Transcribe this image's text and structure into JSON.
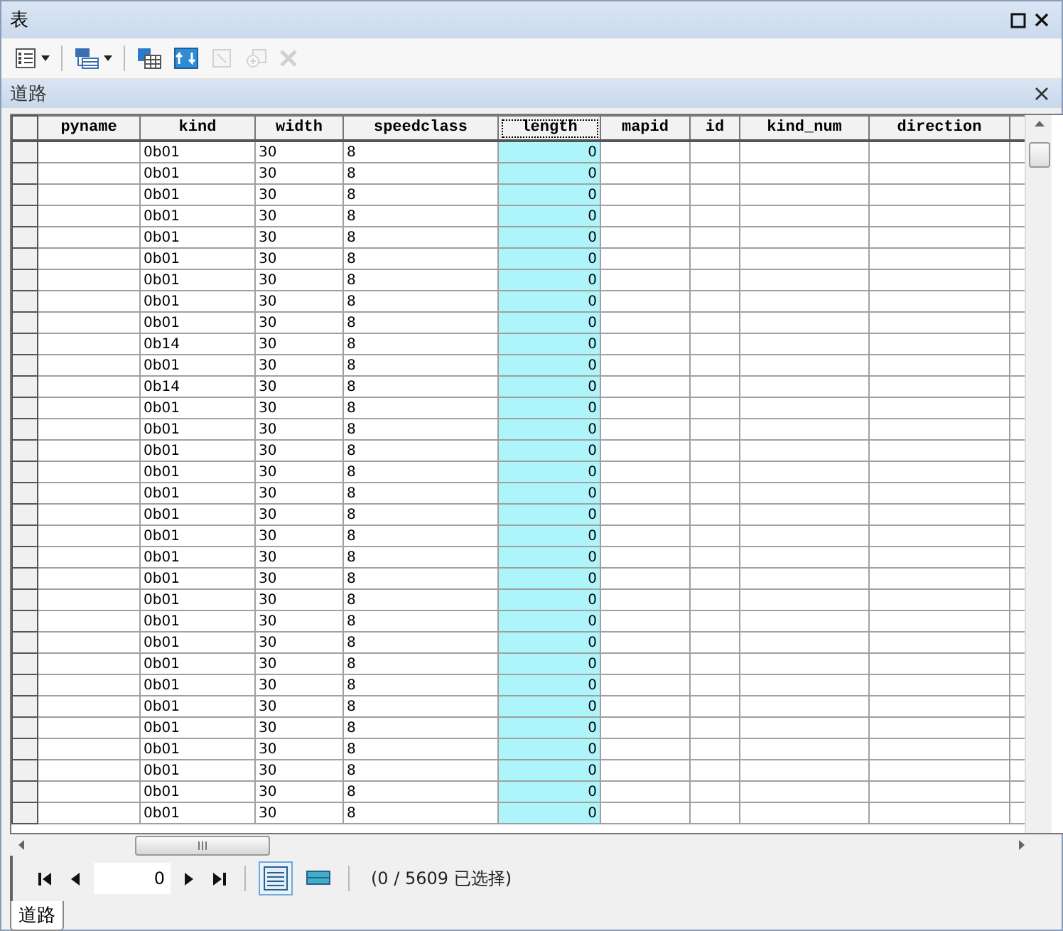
{
  "window": {
    "title": "表"
  },
  "toolbar": [
    {
      "kind": "options",
      "disabled": false,
      "dropdown": true
    },
    {
      "kind": "related",
      "disabled": false,
      "dropdown": true
    },
    {
      "kind": "select-attr",
      "disabled": false,
      "dropdown": false
    },
    {
      "kind": "switch",
      "disabled": false,
      "dropdown": false
    },
    {
      "kind": "clear",
      "disabled": true,
      "dropdown": false
    },
    {
      "kind": "zoom",
      "disabled": true,
      "dropdown": false
    },
    {
      "kind": "delete",
      "disabled": true,
      "dropdown": false
    }
  ],
  "table_title": "道路",
  "columns": [
    {
      "name": "pyname",
      "selected": false,
      "kind": "text"
    },
    {
      "name": "kind",
      "selected": false,
      "kind": "text"
    },
    {
      "name": "width",
      "selected": false,
      "kind": "text"
    },
    {
      "name": "speedclass",
      "selected": false,
      "kind": "text"
    },
    {
      "name": "length",
      "selected": true,
      "kind": "number"
    },
    {
      "name": "mapid",
      "selected": false,
      "kind": "text"
    },
    {
      "name": "id",
      "selected": false,
      "kind": "text"
    },
    {
      "name": "kind_num",
      "selected": false,
      "kind": "text"
    },
    {
      "name": "direction",
      "selected": false,
      "kind": "text"
    }
  ],
  "rows": [
    {
      "cells": [
        "",
        "0b01",
        "30",
        "8",
        "0"
      ]
    },
    {
      "cells": [
        "",
        "0b01",
        "30",
        "8",
        "0"
      ]
    },
    {
      "cells": [
        "",
        "0b01",
        "30",
        "8",
        "0"
      ]
    },
    {
      "cells": [
        "",
        "0b01",
        "30",
        "8",
        "0"
      ]
    },
    {
      "cells": [
        "",
        "0b01",
        "30",
        "8",
        "0"
      ]
    },
    {
      "cells": [
        "",
        "0b01",
        "30",
        "8",
        "0"
      ]
    },
    {
      "cells": [
        "",
        "0b01",
        "30",
        "8",
        "0"
      ]
    },
    {
      "cells": [
        "",
        "0b01",
        "30",
        "8",
        "0"
      ]
    },
    {
      "cells": [
        "",
        "0b01",
        "30",
        "8",
        "0"
      ]
    },
    {
      "cells": [
        "",
        "0b14",
        "30",
        "8",
        "0"
      ]
    },
    {
      "cells": [
        "",
        "0b01",
        "30",
        "8",
        "0"
      ]
    },
    {
      "cells": [
        "",
        "0b14",
        "30",
        "8",
        "0"
      ]
    },
    {
      "cells": [
        "",
        "0b01",
        "30",
        "8",
        "0"
      ]
    },
    {
      "cells": [
        "",
        "0b01",
        "30",
        "8",
        "0"
      ]
    },
    {
      "cells": [
        "",
        "0b01",
        "30",
        "8",
        "0"
      ]
    },
    {
      "cells": [
        "",
        "0b01",
        "30",
        "8",
        "0"
      ]
    },
    {
      "cells": [
        "",
        "0b01",
        "30",
        "8",
        "0"
      ]
    },
    {
      "cells": [
        "",
        "0b01",
        "30",
        "8",
        "0"
      ]
    },
    {
      "cells": [
        "",
        "0b01",
        "30",
        "8",
        "0"
      ]
    },
    {
      "cells": [
        "",
        "0b01",
        "30",
        "8",
        "0"
      ]
    },
    {
      "cells": [
        "",
        "0b01",
        "30",
        "8",
        "0"
      ]
    },
    {
      "cells": [
        "",
        "0b01",
        "30",
        "8",
        "0"
      ]
    },
    {
      "cells": [
        "",
        "0b01",
        "30",
        "8",
        "0"
      ]
    },
    {
      "cells": [
        "",
        "0b01",
        "30",
        "8",
        "0"
      ]
    },
    {
      "cells": [
        "",
        "0b01",
        "30",
        "8",
        "0"
      ]
    },
    {
      "cells": [
        "",
        "0b01",
        "30",
        "8",
        "0"
      ]
    },
    {
      "cells": [
        "",
        "0b01",
        "30",
        "8",
        "0"
      ]
    },
    {
      "cells": [
        "",
        "0b01",
        "30",
        "8",
        "0"
      ]
    },
    {
      "cells": [
        "",
        "0b01",
        "30",
        "8",
        "0"
      ]
    },
    {
      "cells": [
        "",
        "0b01",
        "30",
        "8",
        "0"
      ]
    },
    {
      "cells": [
        "",
        "0b01",
        "30",
        "8",
        "0"
      ]
    },
    {
      "cells": [
        "",
        "0b01",
        "30",
        "8",
        "0"
      ]
    }
  ],
  "navigator": {
    "record": "0",
    "status": "(0 / 5609 已选择)"
  },
  "view_buttons": [
    {
      "kind": "all",
      "selected": true
    },
    {
      "kind": "selected",
      "selected": false
    }
  ],
  "tabs": [
    {
      "label": "道路",
      "selected": true
    }
  ]
}
